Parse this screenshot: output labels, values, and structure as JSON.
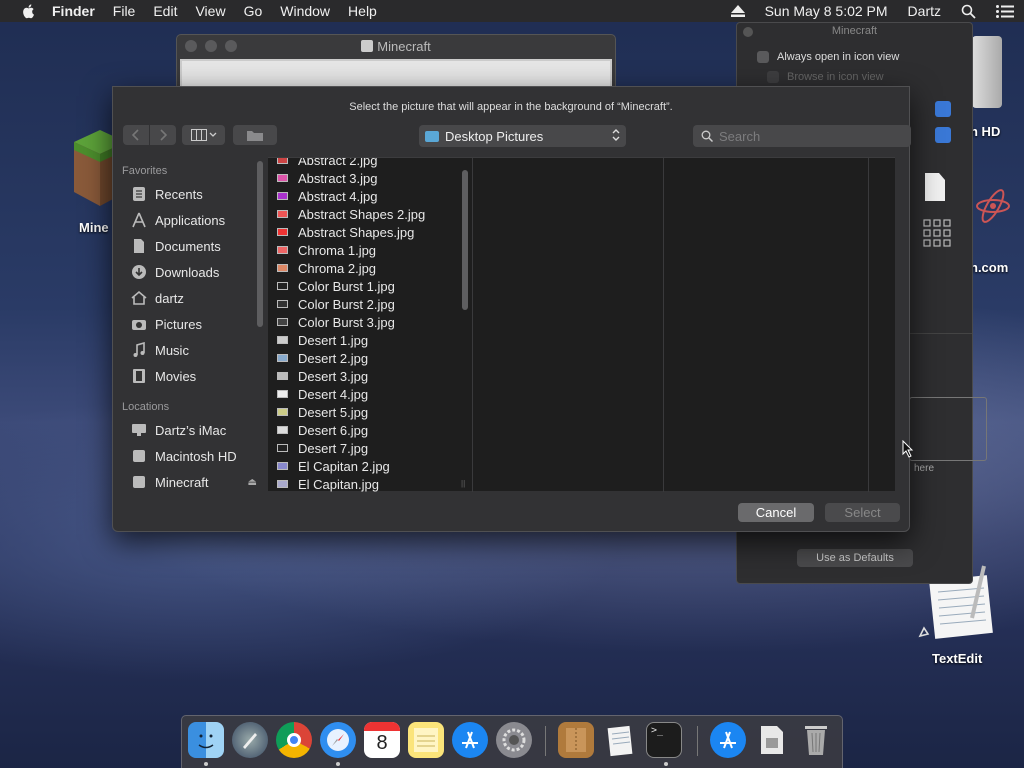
{
  "menubar": {
    "app": "Finder",
    "items": [
      "File",
      "Edit",
      "View",
      "Go",
      "Window",
      "Help"
    ],
    "datetime": "Sun May 8  5:02 PM",
    "user": "Dartz"
  },
  "desktop": {
    "minecraft_label": "Mine",
    "hd_label": "h HD",
    "site_label": "n.com",
    "textedit_label": "TextEdit",
    "here_label": "here"
  },
  "back_window": {
    "title": "Minecraft"
  },
  "inspector": {
    "title": "Minecraft",
    "always_open": "Always open in icon view",
    "browse": "Browse in icon view",
    "use_defaults": "Use as Defaults"
  },
  "dialog": {
    "message": "Select the picture that will appear in the background of “Minecraft”.",
    "location": "Desktop Pictures",
    "search_placeholder": "Search",
    "cancel": "Cancel",
    "select": "Select"
  },
  "sidebar": {
    "favorites_label": "Favorites",
    "favorites": [
      {
        "label": "Recents",
        "icon": "recents-icon"
      },
      {
        "label": "Applications",
        "icon": "applications-icon"
      },
      {
        "label": "Documents",
        "icon": "documents-icon"
      },
      {
        "label": "Downloads",
        "icon": "downloads-icon"
      },
      {
        "label": "dartz",
        "icon": "home-icon"
      },
      {
        "label": "Pictures",
        "icon": "pictures-icon"
      },
      {
        "label": "Music",
        "icon": "music-icon"
      },
      {
        "label": "Movies",
        "icon": "movies-icon"
      }
    ],
    "locations_label": "Locations",
    "locations": [
      {
        "label": "Dartz’s iMac",
        "icon": "imac-icon"
      },
      {
        "label": "Macintosh HD",
        "icon": "disk-icon"
      },
      {
        "label": "Minecraft",
        "icon": "disk-icon"
      }
    ]
  },
  "files": [
    {
      "name": "Abstract 2.jpg",
      "color": "#c44"
    },
    {
      "name": "Abstract 3.jpg",
      "color": "#d5a"
    },
    {
      "name": "Abstract 4.jpg",
      "color": "#a3c"
    },
    {
      "name": "Abstract Shapes 2.jpg",
      "color": "#e55"
    },
    {
      "name": "Abstract Shapes.jpg",
      "color": "#e33"
    },
    {
      "name": "Chroma 1.jpg",
      "color": "#e66"
    },
    {
      "name": "Chroma 2.jpg",
      "color": "#d86"
    },
    {
      "name": "Color Burst 1.jpg",
      "color": "#222"
    },
    {
      "name": "Color Burst 2.jpg",
      "color": "#333"
    },
    {
      "name": "Color Burst 3.jpg",
      "color": "#444"
    },
    {
      "name": "Desert 1.jpg",
      "color": "#ccc"
    },
    {
      "name": "Desert 2.jpg",
      "color": "#8ac"
    },
    {
      "name": "Desert 3.jpg",
      "color": "#bbb"
    },
    {
      "name": "Desert 4.jpg",
      "color": "#eee"
    },
    {
      "name": "Desert 5.jpg",
      "color": "#cc8"
    },
    {
      "name": "Desert 6.jpg",
      "color": "#ddd"
    },
    {
      "name": "Desert 7.jpg",
      "color": "#222"
    },
    {
      "name": "El Capitan 2.jpg",
      "color": "#88c"
    },
    {
      "name": "El Capitan.jpg",
      "color": "#aac"
    }
  ]
}
